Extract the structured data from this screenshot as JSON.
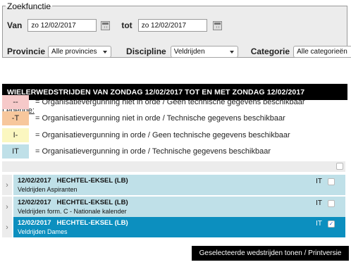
{
  "search": {
    "legend": "Zoekfunctie",
    "from_label": "Van",
    "from_value": "zo 12/02/2017",
    "to_label": "tot",
    "to_value": "zo 12/02/2017",
    "province_label": "Provincie",
    "province_value": "Alle provincies",
    "discipline_label": "Discipline",
    "discipline_value": "Veldrijden",
    "category_label": "Categorie",
    "category_value": "Alle categorieën"
  },
  "heading": "WIELERWEDSTRIJDEN VAN ZONDAG 12/02/2017 TOT EN MET ZONDAG 12/02/2017",
  "legend": {
    "title": "Legende:",
    "items": [
      {
        "code": "--",
        "text": "= Organisatievergunning niet in orde / Geen technische gegevens beschikbaar",
        "color": "#f6c9c9"
      },
      {
        "code": "-T",
        "text": "= Organisatievergunning niet in orde / Technische gegevens beschikbaar",
        "color": "#f7c79c"
      },
      {
        "code": "I-",
        "text": "= Organisatievergunning in orde / Geen technische gegevens beschikbaar",
        "color": "#fbf7c0"
      },
      {
        "code": "IT",
        "text": "= Organisatievergunning in orde / Technische gegevens beschikbaar",
        "color": "#bfe0e8"
      }
    ]
  },
  "races": [
    {
      "date": "12/02/2017",
      "location": "HECHTEL-EKSEL (LB)",
      "type": "Veldrijden Aspiranten",
      "code": "IT",
      "checked": false
    },
    {
      "date": "12/02/2017",
      "location": "HECHTEL-EKSEL (LB)",
      "type": "Veldrijden form. C - Nationale kalender",
      "code": "IT",
      "checked": false
    },
    {
      "date": "12/02/2017",
      "location": "HECHTEL-EKSEL (LB)",
      "type": "Veldrijden Dames",
      "code": "IT",
      "checked": true
    }
  ],
  "icons": {
    "calendar": "calendar-icon",
    "dropdown": "chevron-down-icon",
    "expand": "chevron-right-icon",
    "check": "✓",
    "chevron": "›"
  },
  "colors": {
    "selected_row": "#0c8fbf",
    "row": "#bfe0e8"
  },
  "print_button": "Geselecteerde wedstrijden tonen / Printversie"
}
